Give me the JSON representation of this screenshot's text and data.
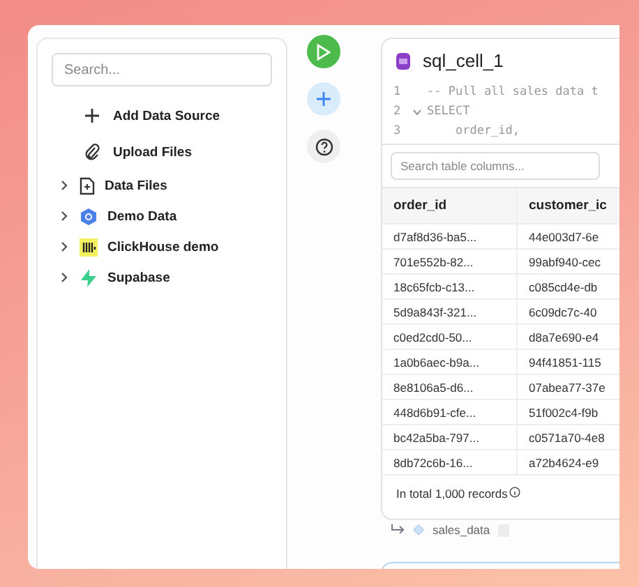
{
  "sidebar": {
    "search": {
      "placeholder": "Search..."
    },
    "actions": [
      {
        "kind": "add",
        "label": "Add Data Source"
      },
      {
        "kind": "upload",
        "label": "Upload Files"
      }
    ],
    "sources": [
      {
        "kind": "files",
        "label": "Data Files",
        "expanded": false
      },
      {
        "kind": "demo",
        "label": "Demo Data",
        "expanded": false
      },
      {
        "kind": "clickhouse",
        "label": "ClickHouse demo",
        "expanded": false
      },
      {
        "kind": "supabase",
        "label": "Supabase",
        "expanded": false
      }
    ]
  },
  "cell": {
    "title": "sql_cell_1",
    "code": [
      {
        "number": "1",
        "fold": false,
        "text": "-- Pull all sales data t"
      },
      {
        "number": "2",
        "fold": true,
        "text": "SELECT"
      },
      {
        "number": "3",
        "fold": false,
        "text": "    order_id,"
      }
    ],
    "column_search": {
      "placeholder": "Search table columns..."
    },
    "columns": [
      "order_id",
      "customer_ic"
    ],
    "rows": [
      [
        "d7af8d36-ba5...",
        "44e003d7-6e"
      ],
      [
        "701e552b-82...",
        "99abf940-cec"
      ],
      [
        "18c65fcb-c13...",
        "c085cd4e-db"
      ],
      [
        "5d9a843f-321...",
        "6c09dc7c-40"
      ],
      [
        "c0ed2cd0-50...",
        "d8a7e690-e4"
      ],
      [
        "1a0b6aec-b9a...",
        "94f41851-115"
      ],
      [
        "8e8106a5-d6...",
        "07abea77-37e"
      ],
      [
        "448d6b91-cfe...",
        "51f002c4-f9b"
      ],
      [
        "bc42a5ba-797...",
        "c0571a70-4e8"
      ],
      [
        "8db72c6b-16...",
        "a72b4624-e9"
      ]
    ],
    "footer": "In total 1,000 records",
    "output": "sales_data"
  }
}
